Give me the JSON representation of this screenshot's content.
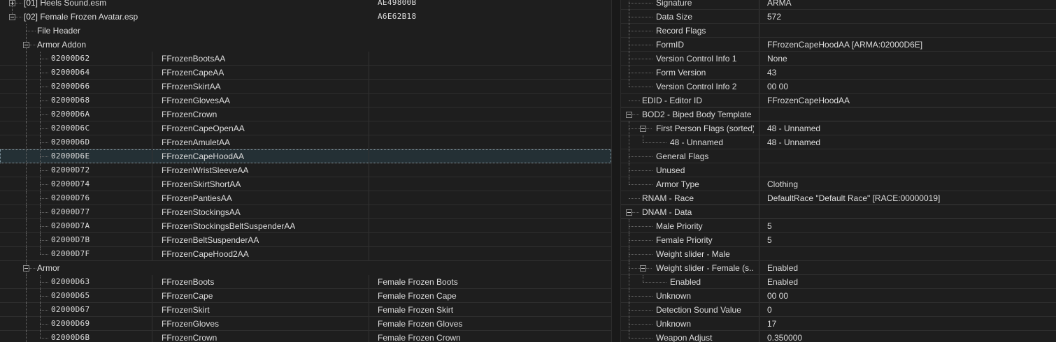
{
  "left_tree": {
    "plugins": [
      {
        "name": "[01] Heels Sound.esm",
        "id": "AE49800B"
      },
      {
        "name": "[02] Female Frozen Avatar.esp",
        "id": "A6E62B18"
      }
    ],
    "file_header": "File Header",
    "armor_addon": {
      "label": "Armor Addon",
      "records": [
        {
          "form_id": "02000D62",
          "editor_id": "FFrozenBootsAA"
        },
        {
          "form_id": "02000D64",
          "editor_id": "FFrozenCapeAA"
        },
        {
          "form_id": "02000D66",
          "editor_id": "FFrozenSkirtAA"
        },
        {
          "form_id": "02000D68",
          "editor_id": "FFrozenGlovesAA"
        },
        {
          "form_id": "02000D6A",
          "editor_id": "FFrozenCrown"
        },
        {
          "form_id": "02000D6C",
          "editor_id": "FFrozenCapeOpenAA"
        },
        {
          "form_id": "02000D6D",
          "editor_id": "FFrozenAmuletAA"
        },
        {
          "form_id": "02000D6E",
          "editor_id": "FFrozenCapeHoodAA"
        },
        {
          "form_id": "02000D72",
          "editor_id": "FFrozenWristSleeveAA"
        },
        {
          "form_id": "02000D74",
          "editor_id": "FFrozenSkirtShortAA"
        },
        {
          "form_id": "02000D76",
          "editor_id": "FFrozenPantiesAA"
        },
        {
          "form_id": "02000D77",
          "editor_id": "FFrozenStockingsAA"
        },
        {
          "form_id": "02000D7A",
          "editor_id": "FFrozenStockingsBeltSuspenderAA"
        },
        {
          "form_id": "02000D7B",
          "editor_id": "FFrozenBeltSuspenderAA"
        },
        {
          "form_id": "02000D7F",
          "editor_id": "FFrozenCapeHood2AA"
        }
      ]
    },
    "armor": {
      "label": "Armor",
      "records": [
        {
          "form_id": "02000D63",
          "editor_id": "FFrozenBoots",
          "name": "Female Frozen Boots"
        },
        {
          "form_id": "02000D65",
          "editor_id": "FFrozenCape",
          "name": "Female Frozen Cape"
        },
        {
          "form_id": "02000D67",
          "editor_id": "FFrozenSkirt",
          "name": "Female Frozen Skirt"
        },
        {
          "form_id": "02000D69",
          "editor_id": "FFrozenGloves",
          "name": "Female Frozen Gloves"
        },
        {
          "form_id": "02000D6B",
          "editor_id": "FFrozenCrown",
          "name": "Female Frozen Crown"
        }
      ]
    },
    "selected_form_id": "02000D6E"
  },
  "right_view": {
    "rows": [
      {
        "label": "Signature",
        "value": "ARMA",
        "level": 1
      },
      {
        "label": "Data Size",
        "value": "572",
        "level": 1
      },
      {
        "label": "Record Flags",
        "value": "",
        "level": 1
      },
      {
        "label": "FormID",
        "value": "FFrozenCapeHoodAA [ARMA:02000D6E]",
        "level": 1
      },
      {
        "label": "Version Control Info 1",
        "value": "None",
        "level": 1
      },
      {
        "label": "Form Version",
        "value": "43",
        "level": 1
      },
      {
        "label": "Version Control Info 2",
        "value": "00 00",
        "level": 1,
        "last": true
      },
      {
        "label": "EDID - Editor ID",
        "value": "FFrozenCapeHoodAA",
        "level": 0
      },
      {
        "label": "BOD2 - Biped Body Template",
        "value": "",
        "level": 0,
        "toggle": true
      },
      {
        "label": "First Person Flags (sorted)",
        "value": "48 - Unnamed",
        "level": 1,
        "toggle": true
      },
      {
        "label": "48 - Unnamed",
        "value": "48 - Unnamed",
        "level": 2,
        "last": true
      },
      {
        "label": "General Flags",
        "value": "",
        "level": 1
      },
      {
        "label": "Unused",
        "value": "",
        "level": 1
      },
      {
        "label": "Armor Type",
        "value": "Clothing",
        "level": 1,
        "last": true
      },
      {
        "label": "RNAM - Race",
        "value": "DefaultRace \"Default Race\" [RACE:00000019]",
        "level": 0
      },
      {
        "label": "DNAM - Data",
        "value": "",
        "level": 0,
        "toggle": true
      },
      {
        "label": "Male Priority",
        "value": "5",
        "level": 1
      },
      {
        "label": "Female Priority",
        "value": "5",
        "level": 1
      },
      {
        "label": "Weight slider - Male",
        "value": "",
        "level": 1
      },
      {
        "label": "Weight slider - Female (s...",
        "value": "Enabled",
        "level": 1,
        "toggle": true
      },
      {
        "label": "Enabled",
        "value": "Enabled",
        "level": 2,
        "last": true
      },
      {
        "label": "Unknown",
        "value": "00 00",
        "level": 1
      },
      {
        "label": "Detection Sound Value",
        "value": "0",
        "level": 1
      },
      {
        "label": "Unknown",
        "value": "17",
        "level": 1
      },
      {
        "label": "Weapon Adjust",
        "value": "0.350000",
        "level": 1
      }
    ]
  }
}
